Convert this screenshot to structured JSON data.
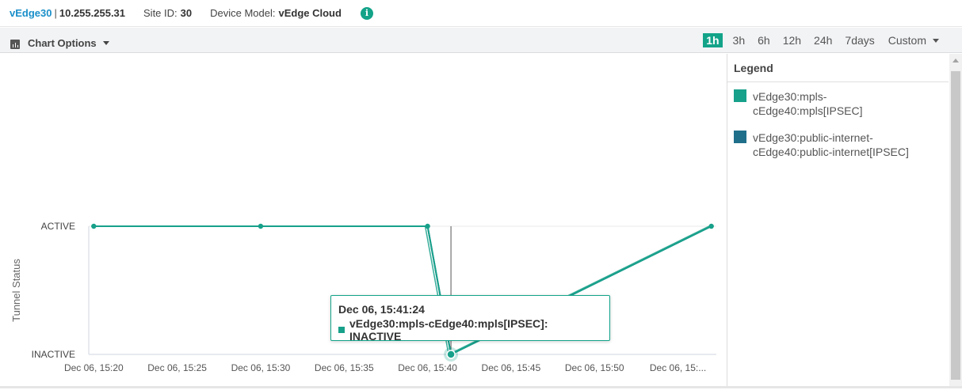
{
  "header": {
    "device_name": "vEdge30",
    "separator": "|",
    "system_ip": "10.255.255.31",
    "site_label": "Site ID:",
    "site_id": "30",
    "model_label": "Device Model:",
    "model": "vEdge Cloud",
    "info_icon_glyph": "i"
  },
  "toolbar": {
    "chart_options_label": "Chart Options",
    "ranges": [
      "1h",
      "3h",
      "6h",
      "12h",
      "24h",
      "7days"
    ],
    "active_range": "1h",
    "custom_label": "Custom"
  },
  "legend": {
    "title": "Legend",
    "items": [
      {
        "label": "vEdge30:mpls-cEdge40:mpls[IPSEC]",
        "color": "#17a08a"
      },
      {
        "label": "vEdge30:public-internet-cEdge40:public-internet[IPSEC]",
        "color": "#1f6f8b"
      }
    ]
  },
  "tooltip": {
    "title": "Dec 06, 15:41:24",
    "row": "vEdge30:mpls-cEdge40:mpls[IPSEC]: INACTIVE",
    "color": "#17a08a"
  },
  "chart_data": {
    "type": "line",
    "ylabel": "Tunnel Status",
    "xlabel": "",
    "y_categories": [
      "INACTIVE",
      "ACTIVE"
    ],
    "x_tick_labels": [
      "Dec 06, 15:20",
      "Dec 06, 15:25",
      "Dec 06, 15:30",
      "Dec 06, 15:35",
      "Dec 06, 15:40",
      "Dec 06, 15:45",
      "Dec 06, 15:50",
      "Dec 06, 15:..."
    ],
    "x_range_minutes": [
      19.7,
      57.3
    ],
    "series": [
      {
        "name": "vEdge30:mpls-cEdge40:mpls[IPSEC]",
        "color": "#17a08a",
        "x": [
          "15:20",
          "15:30",
          "15:40",
          "15:41:24",
          "15:57"
        ],
        "x_minutes": [
          20,
          30,
          40,
          41.4,
          57
        ],
        "y": [
          "ACTIVE",
          "ACTIVE",
          "ACTIVE",
          "INACTIVE",
          "ACTIVE"
        ]
      },
      {
        "name": "vEdge30:public-internet-cEdge40:public-internet[IPSEC]",
        "color": "#1f6f8b",
        "x": [
          "15:40",
          "15:41:24",
          "15:57"
        ],
        "x_minutes": [
          40,
          41.4,
          57
        ],
        "y": [
          "ACTIVE",
          "INACTIVE",
          "ACTIVE"
        ]
      }
    ],
    "hover_x_minutes": 41.4,
    "grid": true
  }
}
